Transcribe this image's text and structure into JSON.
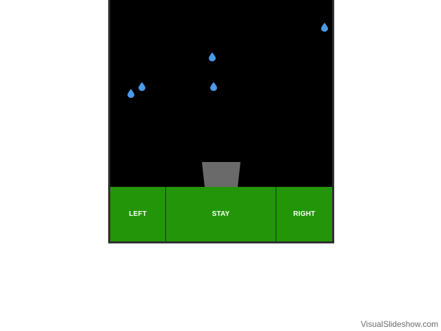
{
  "game": {
    "background_color": "#000000",
    "drop_color": "#4a9bea",
    "bucket_color": "#6a6a6a",
    "drops": [
      {
        "name": "raindrop-1"
      },
      {
        "name": "raindrop-2"
      },
      {
        "name": "raindrop-3"
      },
      {
        "name": "raindrop-4"
      },
      {
        "name": "raindrop-5"
      }
    ]
  },
  "controls": {
    "left_label": "LEFT",
    "stay_label": "STAY",
    "right_label": "RIGHT",
    "color": "#229608"
  },
  "footer": {
    "watermark": "VisualSlideshow.com"
  }
}
